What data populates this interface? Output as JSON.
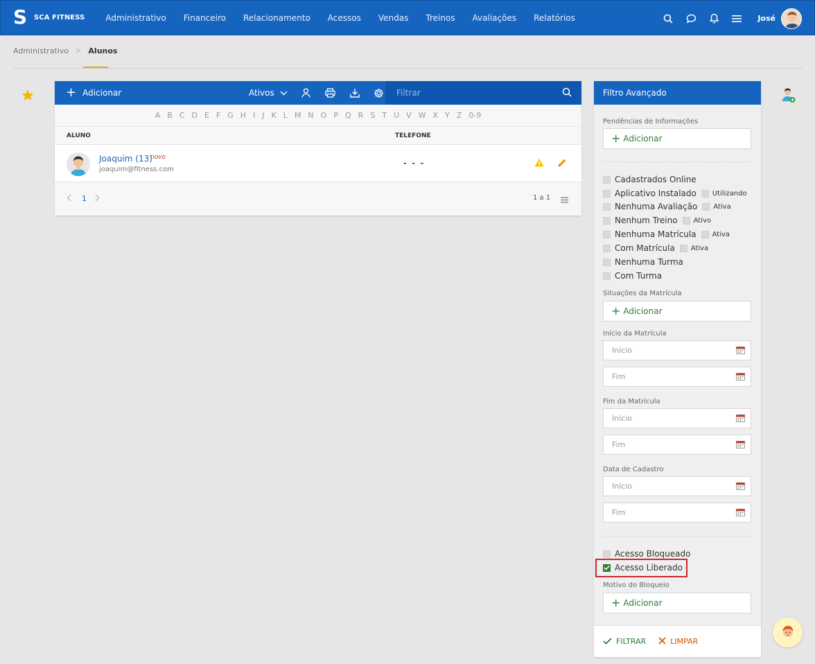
{
  "brand": {
    "name": "SCA FITNESS",
    "logo_letter": "S"
  },
  "menu": [
    "Administrativo",
    "Financeiro",
    "Relacionamento",
    "Acessos",
    "Vendas",
    "Treinos",
    "Avaliações",
    "Relatórios"
  ],
  "user": {
    "name": "José"
  },
  "breadcrumb": {
    "parent": "Administrativo",
    "current": "Alunos"
  },
  "toolbar": {
    "add_label": "Adicionar",
    "status_select": "Ativos",
    "filter_placeholder": "Filtrar"
  },
  "alphabet": [
    "A",
    "B",
    "C",
    "D",
    "E",
    "F",
    "G",
    "H",
    "I",
    "J",
    "K",
    "L",
    "M",
    "N",
    "O",
    "P",
    "Q",
    "R",
    "S",
    "T",
    "U",
    "V",
    "W",
    "X",
    "Y",
    "Z",
    "0-9"
  ],
  "table": {
    "columns": {
      "aluno": "ALUNO",
      "telefone": "TELEFONE"
    },
    "rows": [
      {
        "name": "Joaquim (13)",
        "tag": "novo",
        "email": "joaquim@fitness.com",
        "phone": "- - -"
      }
    ]
  },
  "pagination": {
    "current": "1",
    "count": "1 a 1"
  },
  "filter": {
    "title": "Filtro Avançado",
    "pendencias_label": "Pendências de Informações",
    "add_label": "Adicionar",
    "checks": {
      "cadastrados_online": "Cadastrados Online",
      "aplicativo_instalado": "Aplicativo Instalado",
      "utilizando": "Utilizando",
      "nenhuma_avaliacao": "Nenhuma Avaliação",
      "ativa": "Ativa",
      "nenhum_treino": "Nenhum Treino",
      "ativo": "Ativo",
      "nenhuma_matricula": "Nenhuma Matrícula",
      "com_matricula": "Com Matrícula",
      "nenhuma_turma": "Nenhuma Turma",
      "com_turma": "Com Turma",
      "acesso_bloqueado": "Acesso Bloqueado",
      "acesso_liberado": "Acesso Liberado"
    },
    "acesso_liberado_checked": true,
    "situacoes_label": "Situações da Matrícula",
    "inicio_matricula_label": "Início da Matrícula",
    "fim_matricula_label": "Fim da Matrícula",
    "data_cadastro_label": "Data de Cadastro",
    "inicio_placeholder": "Início",
    "fim_placeholder": "Fim",
    "motivo_label": "Motivo do Bloqueio",
    "filtrar_btn": "FILTRAR",
    "limpar_btn": "LIMPAR"
  },
  "colors": {
    "primary": "#1565c0",
    "green": "#2e7d32",
    "accent": "#f0a030",
    "highlight": "#c62828"
  }
}
